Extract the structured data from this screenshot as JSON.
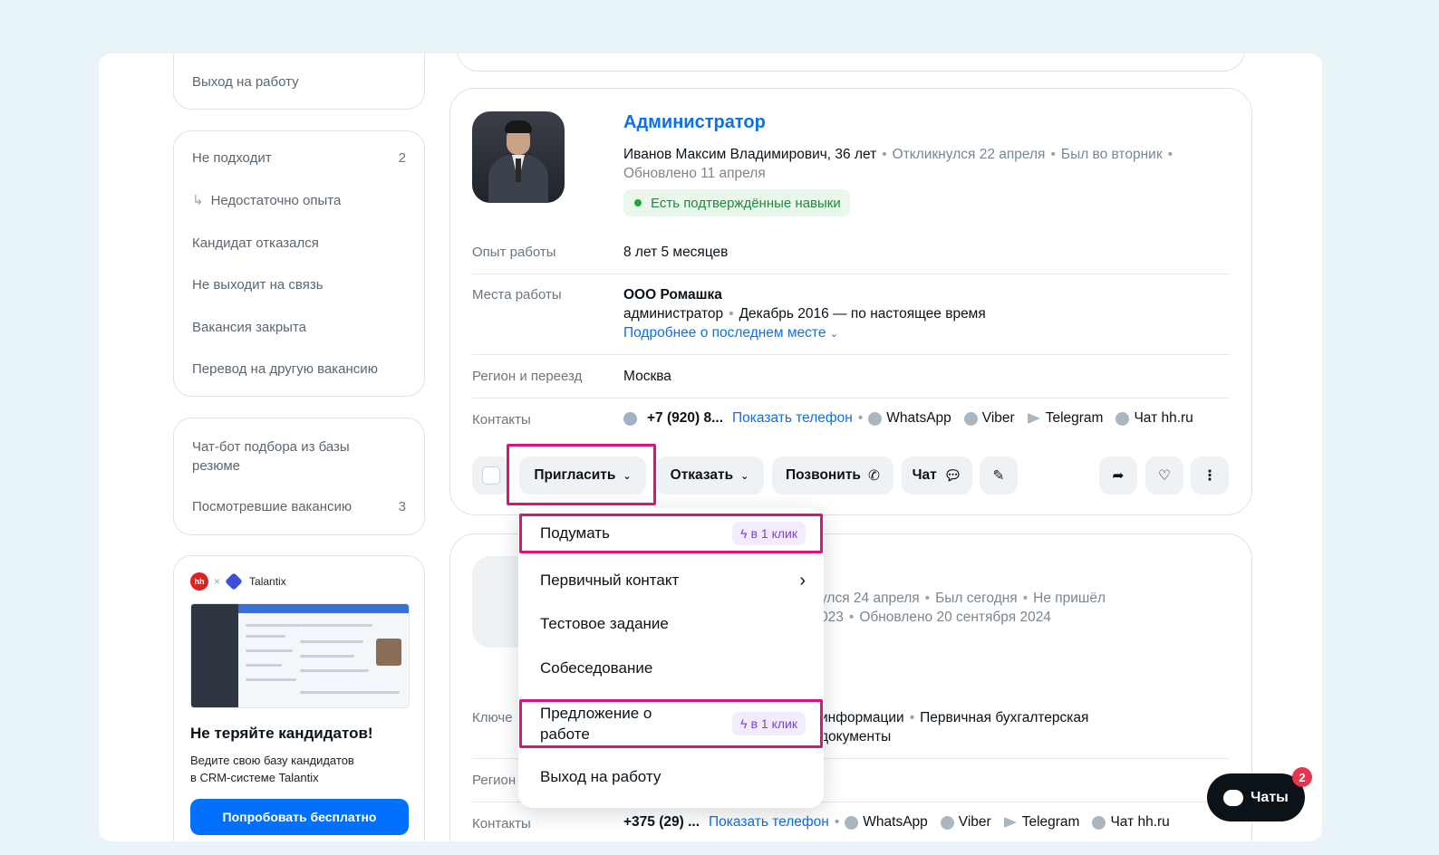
{
  "sidebar": {
    "top_item": "Выход на работу",
    "reject_group": [
      {
        "label": "Не подходит",
        "count": "2"
      },
      {
        "label": "Недостаточно опыта",
        "count": ""
      },
      {
        "label": "Кандидат отказался",
        "count": ""
      },
      {
        "label": "Не выходит на связь",
        "count": ""
      },
      {
        "label": "Вакансия закрыта",
        "count": ""
      },
      {
        "label": "Перевод на другую вакансию",
        "count": ""
      }
    ],
    "bot_group": [
      {
        "label": "Чат-бот подбора из базы резюме",
        "count": ""
      },
      {
        "label": "Посмотревшие вакансию",
        "count": "3"
      }
    ],
    "promo": {
      "hh": "hh",
      "times": "×",
      "brand": "Talantix",
      "title": "Не теряйте кандидатов!",
      "text_1": "Ведите свою базу кандидатов",
      "text_2": "в CRM-системе Talantix",
      "button": "Попробовать бесплатно"
    }
  },
  "candidate1": {
    "vacancy": "Администратор",
    "name_age": "Иванов Максим Владимирович, 36 лет",
    "responded": "Откликнулся 22 апреля",
    "last_seen": "Был во вторник",
    "updated": "Обновлено 11 апреля",
    "skills_badge": "Есть подтверждённые навыки",
    "experience_label": "Опыт работы",
    "experience_value": "8 лет 5 месяцев",
    "workplaces_label": "Места работы",
    "company": "ООО Ромашка",
    "position": "администратор",
    "period": "Декабрь 2016 — по настоящее время",
    "more_link": "Подробнее о последнем месте",
    "region_label": "Регион и переезд",
    "region_value": "Москва",
    "contacts_label": "Контакты",
    "phone": "+7 (920) 8...",
    "show_phone": "Показать телефон",
    "whatsapp": "WhatsApp",
    "viber": "Viber",
    "telegram": "Telegram",
    "hh_chat": "Чат hh.ru"
  },
  "actions": {
    "invite": "Пригласить",
    "reject": "Отказать",
    "call": "Позвонить",
    "chat": "Чат"
  },
  "invite_menu": {
    "items": [
      {
        "label": "Подумать",
        "badge": "в 1 клик"
      },
      {
        "label": "Первичный контакт",
        "badge": ""
      },
      {
        "label": "Тестовое задание",
        "badge": ""
      },
      {
        "label": "Собеседование",
        "badge": ""
      },
      {
        "label": "Предложение о работе",
        "badge": "в 1 клик"
      },
      {
        "label": "Выход на работу",
        "badge": ""
      }
    ]
  },
  "candidate2": {
    "meta_line1_a": "улся 24 апреля",
    "meta_line1_b": "Был сегодня",
    "meta_line1_c": "Не пришёл",
    "meta_line2_a": "023",
    "meta_line2_b": "Обновлено 20 сентября 2024",
    "key_label": "Ключе",
    "skills_a": "информации",
    "skills_b": "Первичная бухгалтерская",
    "skills_c": "документы",
    "region_label": "Регион",
    "contacts_label": "Контакты",
    "phone": "+375 (29) ...",
    "show_phone": "Показать телефон",
    "whatsapp": "WhatsApp",
    "viber": "Viber",
    "telegram": "Telegram",
    "hh_chat": "Чат hh.ru"
  },
  "chat_fab": {
    "label": "Чаты",
    "count": "2"
  },
  "colors": {
    "accent": "#0a70f0",
    "highlight": "#d6167a",
    "badge": "#7b3fe4",
    "success": "#1d8c3a"
  }
}
